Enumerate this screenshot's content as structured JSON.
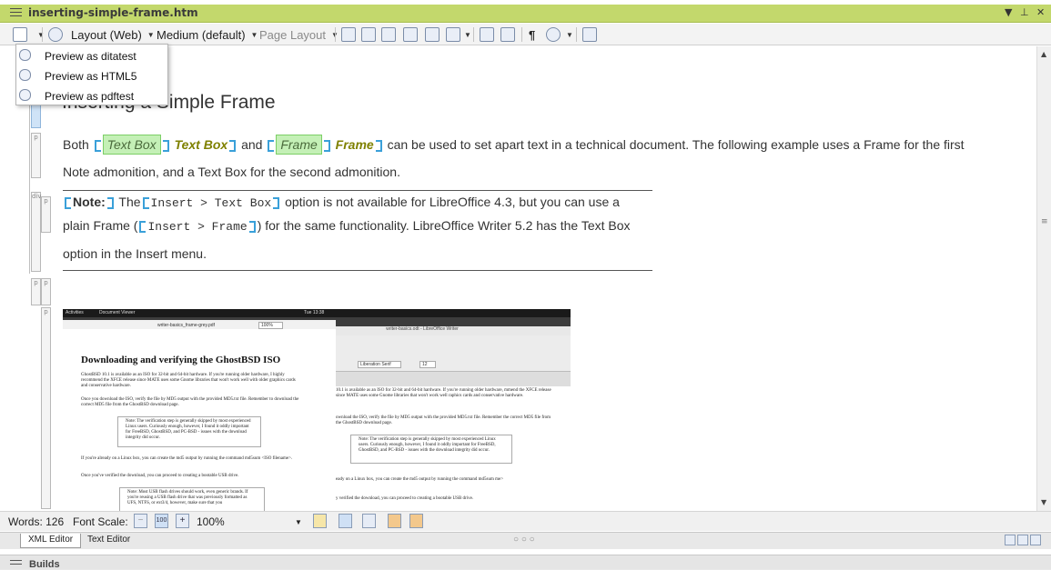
{
  "window": {
    "title": "inserting-simple-frame.htm",
    "accent": "#c3d86c"
  },
  "toolbar": {
    "layout_label": "Layout (Web)",
    "style_label": "Medium (default)",
    "page_layout_label": "Page Layout",
    "icons": [
      "preview-icon",
      "css-icon",
      "tag-icon",
      "image-icon",
      "link-icon",
      "xref-icon",
      "text-icon",
      "pilcrow-icon",
      "eye-icon",
      "export-icon"
    ]
  },
  "preview_menu": {
    "items": [
      {
        "label": "Preview as ditatest"
      },
      {
        "label": "Preview as HTML5"
      },
      {
        "label": "Preview as pdftest"
      }
    ]
  },
  "gutter": {
    "tags": [
      "p",
      "p",
      "div",
      "p",
      "p",
      "p"
    ]
  },
  "document": {
    "heading": "Inserting a Simple Frame",
    "para1": {
      "start": "Both",
      "uitag1": "Text Box",
      "kw1": "Text Box",
      "and": "and",
      "uitag2": "Frame",
      "kw2": "Frame",
      "rest": "can be used to set apart text in a technical document. The following example uses a Frame for the first",
      "line2": "Note admonition, and a Text Box for the second admonition."
    },
    "note": {
      "label": "Note:",
      "the": "The",
      "code1": "Insert > Text Box",
      "text1": "option is not available for LibreOffice 4.3, but you can use a",
      "text2a": "plain Frame (",
      "code2": "Insert > Frame",
      "text2b": ") for the same functionality. LibreOffice Writer 5.2 has the Text Box",
      "text3": "option in the Insert menu."
    },
    "screenshot": {
      "topbar_activities": "Activities",
      "topbar_app": "Document Viewer",
      "topbar_time": "Tue 13:38",
      "pdf_name": "writer-basics_frame-grey.pdf",
      "pdf_zoom": "100%",
      "writer_title": "writer-basics.odt - LibreOffice Writer",
      "writer_font": "Liberation Serif",
      "writer_size": "12",
      "pdf_heading": "Downloading and verifying the GhostBSD ISO",
      "pdf_p1": "GhostBSD 10.1 is available as an ISO for 32-bit and 64-bit hardware. If you're running older hardware, I highly recommend the XFCE release since MATE uses some Gnome libraries that won't work well with older graphics cards and conservative hardware.",
      "pdf_p2": "Once you download the ISO, verify the file by MD5 output with the provided MD5.txt file. Remember to download the correct MD5 file from the GhostBSD download page.",
      "pdf_note": "Note: The verification step is generally skipped by most experienced Linux users. Curiously enough, however, I found it oddly important for FreeBSD, GhostBSD, and PC-BSD - issues with the download integrity did occur.",
      "pdf_p3": "If you're already on a Linux box, you can create the md5 output by running the command md5sum <ISO filename>.",
      "pdf_p4": "Once you've verified the download, you can proceed to creating a bootable USB drive.",
      "pdf_note2": "Note: Most USB flash drives should work, even generic brands. If you're reusing a USB flash drive that was previously formatted as UFS, NTFS, or ext3/4, however, make sure that you",
      "writer_p1": "10.1 is available as an ISO for 32-bit and 64-bit hardware. If you're running older hardware, mmend the XFCE release since MATE uses some Gnome libraries that won't work well raphics cards and conservative hardware.",
      "writer_p2": "ownload the ISO, verify the file by MD5 output with the provided MD5.txt file. Remember the correct MD5 file from the GhostBSD download page.",
      "writer_note": "Note: The verification step is generally skipped by most experienced Linux users. Curiously enough, however, I found it oddly important for FreeBSD, GhostBSD, and PC-BSD - issues with the download integrity did occur.",
      "writer_p3": "eady on a Linux box, you can create the md5 output by running the command md5sum me>",
      "writer_p4": "y verified the download, you can proceed to creating a bootable USB drive."
    }
  },
  "statusbar": {
    "words": "Words: 126",
    "font_scale": "Font Scale:",
    "zoom": "100%"
  },
  "tabs": {
    "xml_editor": "XML Editor",
    "text_editor": "Text Editor",
    "dots": "○ ○ ○"
  },
  "builds": {
    "label": "Builds"
  }
}
